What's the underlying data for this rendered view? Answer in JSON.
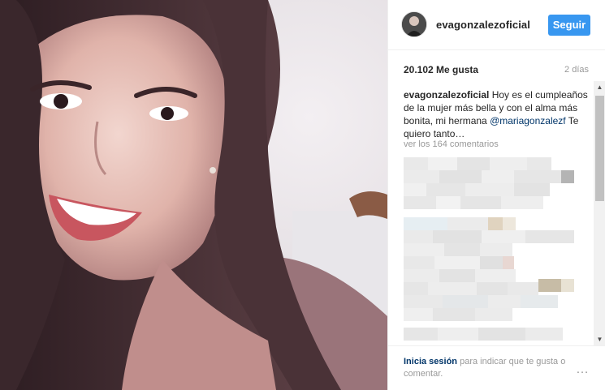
{
  "header": {
    "username": "evagonzalezoficial",
    "follow_label": "Seguir"
  },
  "stats": {
    "likes": "20.102 Me gusta",
    "time_ago": "2 días"
  },
  "caption": {
    "user": "evagonzalezoficial",
    "text_before": " Hoy es el cumpleaños de la mujer más bella y con el alma más bonita, mi hermana ",
    "mention": "@mariagonzalezf",
    "text_after": " Te quiero tanto…"
  },
  "comments": {
    "view_all": "ver los 164 comentarios"
  },
  "footer": {
    "login_link": "Inicia sesión",
    "login_rest": " para indicar que te gusta o comentar.",
    "more_icon": "…"
  },
  "colors": {
    "accent": "#3897f0",
    "link": "#003569",
    "muted": "#999999"
  }
}
